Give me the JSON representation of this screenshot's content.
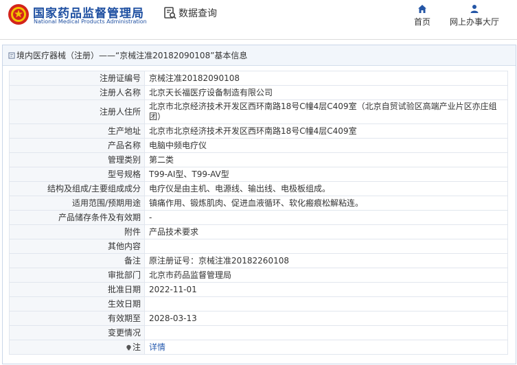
{
  "header": {
    "brand_cn": "国家药品监督管理局",
    "brand_en": "National Medical Products Administration",
    "query_label": "数据查询",
    "nav": [
      {
        "label": "首页",
        "icon": "home-icon"
      },
      {
        "label": "网上办事大厅",
        "icon": "user-icon"
      }
    ]
  },
  "panel": {
    "title": "境内医疗器械（注册）——“京械注准20182090108”基本信息"
  },
  "details": {
    "reg_no": {
      "label": "注册证编号",
      "value": "京械注准20182090108"
    },
    "registrant": {
      "label": "注册人名称",
      "value": "北京天长福医疗设备制造有限公司"
    },
    "registrant_addr": {
      "label": "注册人住所",
      "value": "北京市北京经济技术开发区西环南路18号C幢4层C409室（北京自贸试验区高端产业片区亦庄组团）"
    },
    "production_addr": {
      "label": "生产地址",
      "value": "北京市北京经济技术开发区西环南路18号C幢4层C409室"
    },
    "product_name": {
      "label": "产品名称",
      "value": "电脑中频电疗仪"
    },
    "category": {
      "label": "管理类别",
      "value": "第二类"
    },
    "model": {
      "label": "型号规格",
      "value": "T99-AI型、T99-AV型"
    },
    "structure": {
      "label": "结构及组成/主要组成成分",
      "value": "电疗仪是由主机、电源线、输出线、电极板组成。"
    },
    "scope": {
      "label": "适用范围/预期用途",
      "value": "镇痛作用、锻炼肌肉、促进血液循环、软化瘢痕松解粘连。"
    },
    "storage": {
      "label": "产品储存条件及有效期",
      "value": "-"
    },
    "attachment": {
      "label": "附件",
      "value": "产品技术要求"
    },
    "other": {
      "label": "其他内容",
      "value": ""
    },
    "remarks": {
      "label": "备注",
      "value": "原注册证号：京械注准20182260108"
    },
    "approval_dept": {
      "label": "审批部门",
      "value": "北京市药品监督管理局"
    },
    "approval_date": {
      "label": "批准日期",
      "value": "2022-11-01"
    },
    "effective_date": {
      "label": "生效日期",
      "value": ""
    },
    "valid_until": {
      "label": "有效期至",
      "value": "2028-03-13"
    },
    "changes": {
      "label": "变更情况",
      "value": ""
    },
    "note": {
      "label": "注",
      "value": "详情"
    }
  },
  "colors": {
    "brand_blue": "#1e4fa1",
    "emblem_red": "#d3241c",
    "link_blue": "#2a5db0"
  }
}
